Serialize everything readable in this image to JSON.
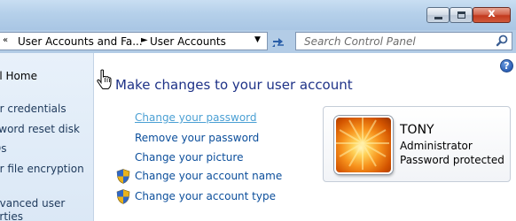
{
  "window": {
    "caption_buttons": {
      "minimize": "minimize",
      "maximize": "maximize",
      "close": "x"
    }
  },
  "address_bar": {
    "overflow": "«",
    "crumbs": [
      "User Accounts and Fa...",
      "User Accounts"
    ],
    "separator": "►"
  },
  "search": {
    "placeholder": "Search Control Panel"
  },
  "left_pane": {
    "items": [
      {
        "label": "el Home"
      },
      {
        "label": "ur credentials"
      },
      {
        "label": "sword reset disk"
      },
      {
        "label": "Ds"
      },
      {
        "label": "ur file encryption"
      },
      {
        "label": "dvanced user"
      },
      {
        "label": "erties"
      }
    ]
  },
  "main": {
    "title": "Make changes to your user account",
    "tasks": [
      {
        "label": "Change your password",
        "shield": false
      },
      {
        "label": "Remove your password",
        "shield": false
      },
      {
        "label": "Change your picture",
        "shield": false
      },
      {
        "label": "Change your account name",
        "shield": true
      },
      {
        "label": "Change your account type",
        "shield": true
      }
    ],
    "help_icon": "?"
  },
  "user_card": {
    "name": "TONY",
    "role": "Administrator",
    "status": "Password protected"
  },
  "colors": {
    "accent": "#1e3287",
    "link": "#0b4e9b",
    "link_hover": "#4ba0d4"
  }
}
